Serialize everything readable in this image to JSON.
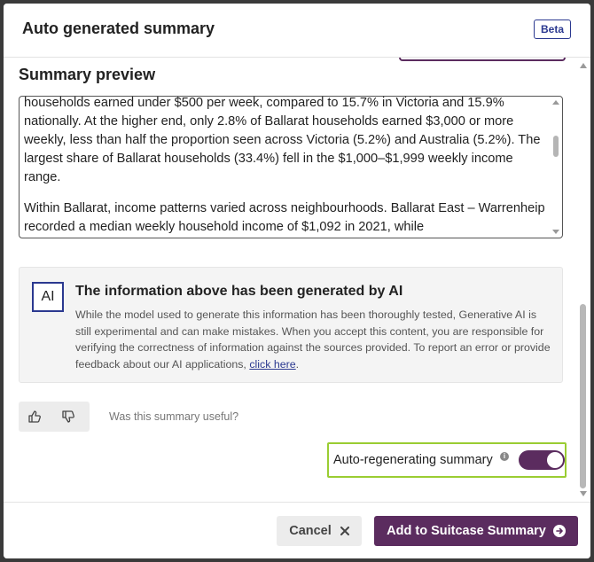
{
  "dialog": {
    "title": "Auto generated summary",
    "badge": "Beta"
  },
  "preview": {
    "heading": "Summary preview",
    "paragraphs": [
      "households earned under $500 per week, compared to 15.7% in Victoria and 15.9% nationally. At the higher end, only 2.8% of Ballarat households earned $3,000 or more weekly, less than half the proportion seen across Victoria (5.2%) and Australia (5.2%). The largest share of Ballarat households (33.4%) fell in the $1,000–$1,999 weekly income range.",
      "Within Ballarat, income patterns varied across neighbourhoods. Ballarat East – Warrenheip recorded a median weekly household income of $1,092 in 2021, while"
    ]
  },
  "ai_notice": {
    "badge": "AI",
    "title": "The information above has been generated by AI",
    "text": "While the model used to generate this information has been thoroughly tested, Generative AI is still experimental and can make mistakes. When you accept this content, you are responsible for verifying the correctness of information against the sources provided. To report an error or provide feedback about our AI applications, ",
    "link": "click here",
    "text_end": "."
  },
  "feedback": {
    "question": "Was this summary useful?"
  },
  "auto_regen": {
    "label": "Auto-regenerating summary",
    "enabled": true
  },
  "footer": {
    "cancel_label": "Cancel",
    "add_label": "Add to Suitcase Summary"
  },
  "colors": {
    "accent": "#5b2c5f",
    "badge_blue": "#2b3990",
    "highlight": "#9acd32"
  }
}
